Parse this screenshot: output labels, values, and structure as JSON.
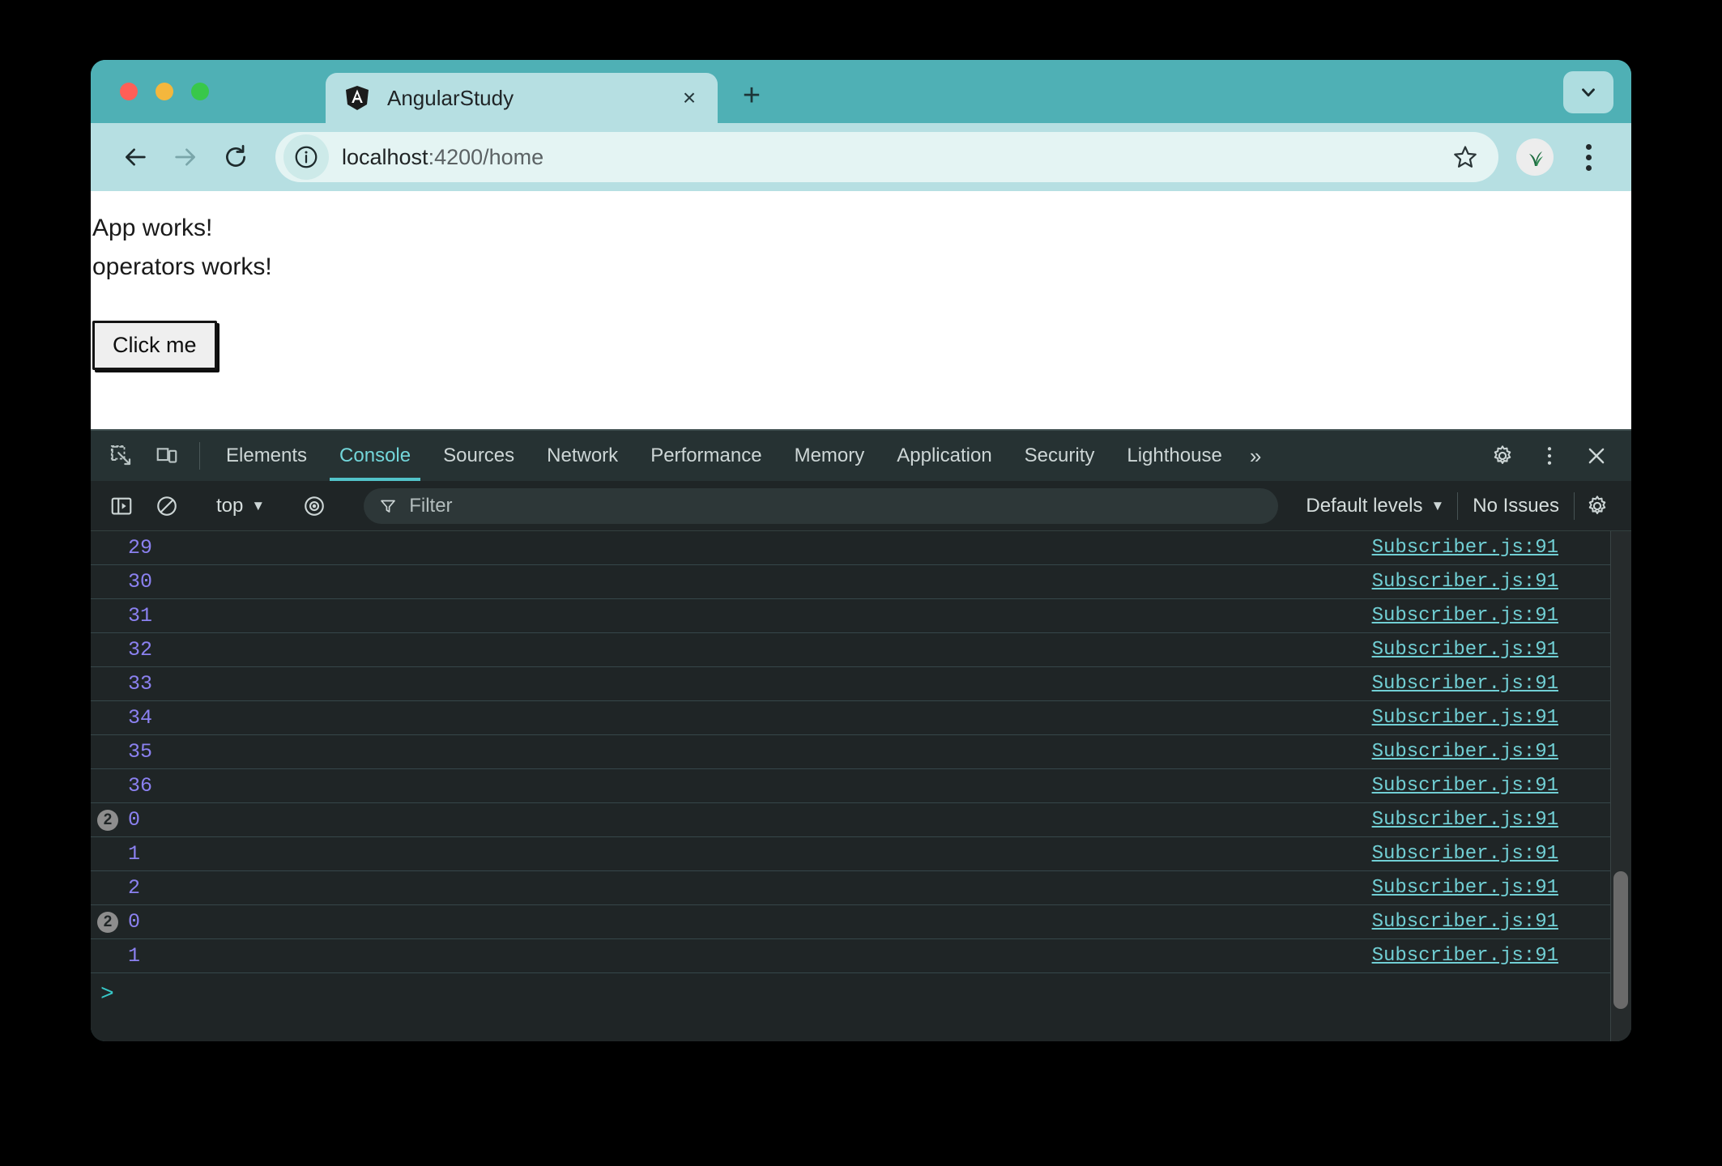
{
  "browser": {
    "traffic_lights": [
      "close",
      "minimize",
      "maximize"
    ],
    "tab": {
      "title": "AngularStudy",
      "favicon": "angular-logo-icon",
      "close_label": "×"
    },
    "new_tab_label": "+",
    "tab_search_icon": "chevron-down-icon",
    "toolbar": {
      "back_icon": "arrow-left-icon",
      "forward_icon": "arrow-right-icon",
      "reload_icon": "reload-icon",
      "info_icon": "info-circle-icon",
      "url_host": "localhost",
      "url_rest": ":4200/home",
      "url_full": "localhost:4200/home",
      "star_icon": "star-icon",
      "avatar_icon": "profile-avatar-icon",
      "menu_icon": "kebab-menu-icon"
    }
  },
  "page": {
    "lines": [
      "App works!",
      "operators works!"
    ],
    "button_label": "Click me"
  },
  "devtools": {
    "left_icons": [
      "inspect-element-icon",
      "device-toolbar-icon"
    ],
    "tabs": [
      {
        "label": "Elements",
        "active": false
      },
      {
        "label": "Console",
        "active": true
      },
      {
        "label": "Sources",
        "active": false
      },
      {
        "label": "Network",
        "active": false
      },
      {
        "label": "Performance",
        "active": false
      },
      {
        "label": "Memory",
        "active": false
      },
      {
        "label": "Application",
        "active": false
      },
      {
        "label": "Security",
        "active": false
      },
      {
        "label": "Lighthouse",
        "active": false
      }
    ],
    "more_tabs_label": "»",
    "settings_icon": "gear-icon",
    "more_options_icon": "kebab-menu-icon",
    "close_icon": "close-icon",
    "console_toolbar": {
      "sidebar_icon": "console-sidebar-icon",
      "clear_icon": "clear-console-icon",
      "context_label": "top",
      "eye_icon": "live-expression-eye-icon",
      "filter_icon": "funnel-icon",
      "filter_placeholder": "Filter",
      "levels_label": "Default levels",
      "issues_label": "No Issues",
      "console_settings_icon": "gear-icon"
    },
    "console_messages": [
      {
        "badge": "",
        "text": "29",
        "source": "Subscriber.js:91"
      },
      {
        "badge": "",
        "text": "30",
        "source": "Subscriber.js:91"
      },
      {
        "badge": "",
        "text": "31",
        "source": "Subscriber.js:91"
      },
      {
        "badge": "",
        "text": "32",
        "source": "Subscriber.js:91"
      },
      {
        "badge": "",
        "text": "33",
        "source": "Subscriber.js:91"
      },
      {
        "badge": "",
        "text": "34",
        "source": "Subscriber.js:91"
      },
      {
        "badge": "",
        "text": "35",
        "source": "Subscriber.js:91"
      },
      {
        "badge": "",
        "text": "36",
        "source": "Subscriber.js:91"
      },
      {
        "badge": "2",
        "text": "0",
        "source": "Subscriber.js:91"
      },
      {
        "badge": "",
        "text": "1",
        "source": "Subscriber.js:91"
      },
      {
        "badge": "",
        "text": "2",
        "source": "Subscriber.js:91"
      },
      {
        "badge": "2",
        "text": "0",
        "source": "Subscriber.js:91"
      },
      {
        "badge": "",
        "text": "1",
        "source": "Subscriber.js:91"
      }
    ],
    "prompt_symbol": ">"
  },
  "colors": {
    "tabstrip": "#4fb0b5",
    "toolbar": "#b6dfe2",
    "omnibox": "#e4f4f3",
    "devtools_bg": "#1f2526",
    "devtools_tabbar": "#263233",
    "accent_cyan": "#73d6da",
    "value_purple": "#8b81f0",
    "link_cyan": "#71cfd4"
  }
}
